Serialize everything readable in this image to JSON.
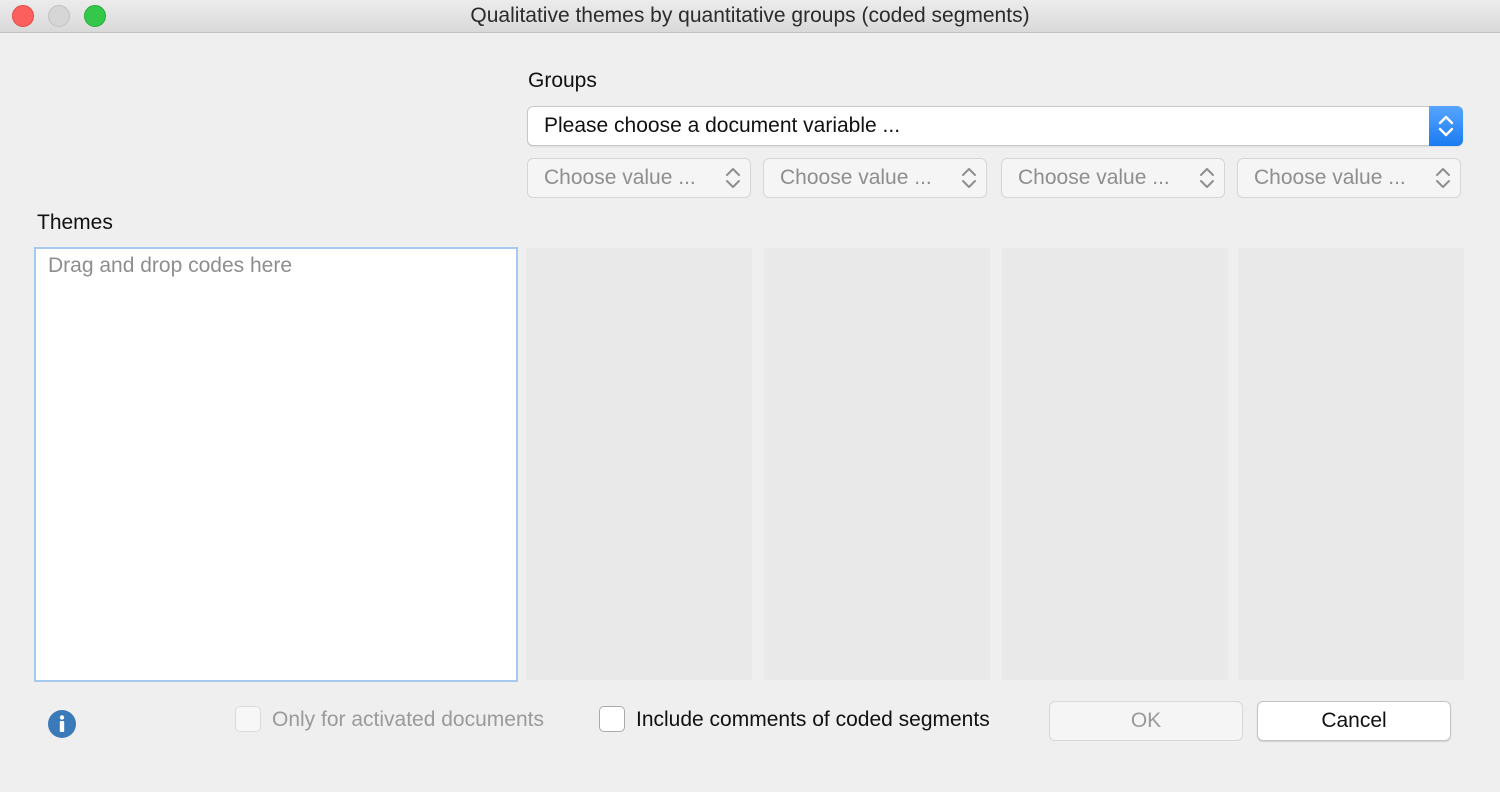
{
  "window": {
    "title": "Qualitative themes by quantitative groups (coded segments)"
  },
  "groups": {
    "label": "Groups",
    "variable_select": "Please choose a document variable ...",
    "value_selects": [
      "Choose value ...",
      "Choose value ...",
      "Choose value ...",
      "Choose value ..."
    ]
  },
  "themes": {
    "label": "Themes",
    "placeholder": "Drag and drop codes here"
  },
  "footer": {
    "only_activated_label": "Only for activated documents",
    "only_activated_checked": false,
    "include_comments_label": "Include comments of coded segments",
    "include_comments_checked": false,
    "ok_label": "OK",
    "cancel_label": "Cancel"
  },
  "icons": {
    "info": "info-icon",
    "select_stepper": "chevron-up-down-icon"
  },
  "colors": {
    "accent": "#1a7bf1",
    "info": "#3a7ab8",
    "focus_border": "#a7c8ef"
  }
}
